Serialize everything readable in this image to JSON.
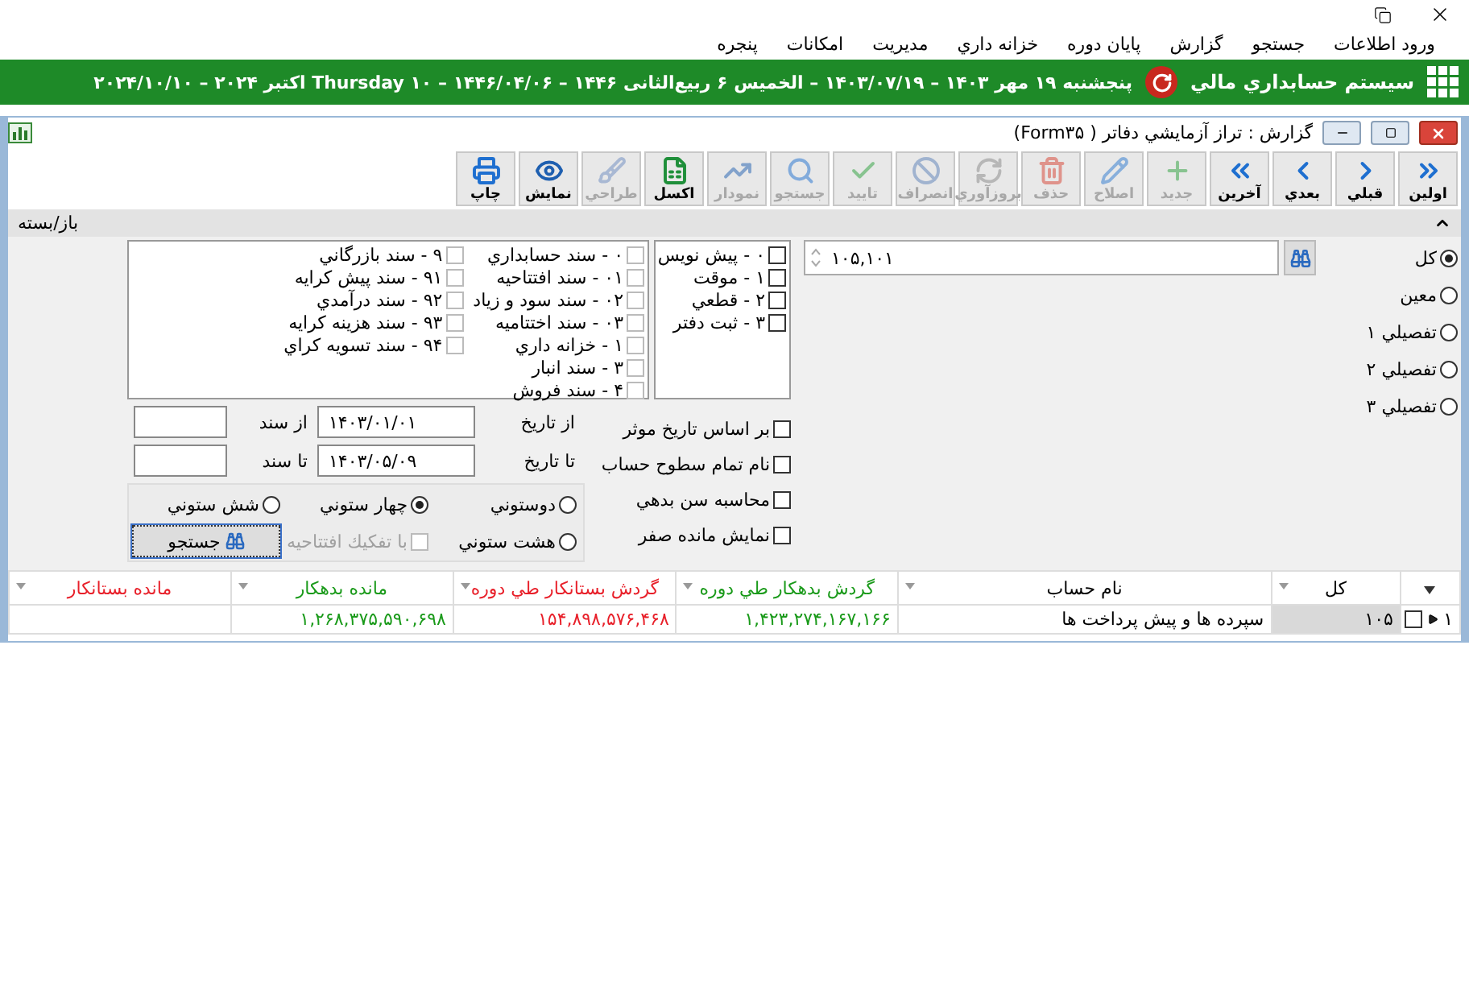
{
  "menu": [
    "ورود اطلاعات",
    "جستجو",
    "گزارش",
    "پايان دوره",
    "خزانه داري",
    "مديريت",
    "امكانات",
    "پنجره"
  ],
  "app_bar": {
    "title": "سيستم حسابداري مالي",
    "date": "پنجشنبه ۱۹ مهر ۱۴۰۳ – ۱۴۰۳/۰۷/۱۹ – الخميس ۶ ربيع‌الثانى ۱۴۴۶ – ۱۴۴۶/۰۴/۰۶ – ۱۰ Thursday اكتبر ۲۰۲۴ – ۲۰۲۴/۱۰/۱۰"
  },
  "form_window": {
    "title": "گزارش : تراز آزمايشي دفاتر ( Form۳۵)"
  },
  "toolbar": [
    {
      "label": "اولين",
      "kind": "first",
      "disabled": false
    },
    {
      "label": "قبلي",
      "kind": "prev",
      "disabled": false
    },
    {
      "label": "بعدي",
      "kind": "next",
      "disabled": false
    },
    {
      "label": "آخرين",
      "kind": "last",
      "disabled": false
    },
    {
      "label": "جديد",
      "kind": "new",
      "disabled": true
    },
    {
      "label": "اصلاح",
      "kind": "edit",
      "disabled": true
    },
    {
      "label": "حذف",
      "kind": "delete",
      "disabled": true
    },
    {
      "label": "بروزآوري",
      "kind": "refresh",
      "disabled": true
    },
    {
      "label": "انصراف",
      "kind": "cancel",
      "disabled": true
    },
    {
      "label": "تاييد",
      "kind": "confirm",
      "disabled": true
    },
    {
      "label": "جستجو",
      "kind": "search",
      "disabled": true
    },
    {
      "label": "نمودار",
      "kind": "chart",
      "disabled": true
    },
    {
      "label": "اكسل",
      "kind": "excel",
      "disabled": false
    },
    {
      "label": "طراحي",
      "kind": "design",
      "disabled": true
    },
    {
      "label": "نمايش",
      "kind": "view",
      "disabled": false
    },
    {
      "label": "چاپ",
      "kind": "print",
      "disabled": false
    }
  ],
  "panel": {
    "label": "باز/بسته",
    "expanded": true
  },
  "levels": [
    {
      "label": "كل",
      "selected": true
    },
    {
      "label": "معين",
      "selected": false
    },
    {
      "label": "تفصيلي ۱",
      "selected": false
    },
    {
      "label": "تفصيلي ۲",
      "selected": false
    },
    {
      "label": "تفصيلي ۳",
      "selected": false
    }
  ],
  "account_field": {
    "value": "۱۰۵,۱۰۱"
  },
  "statuses": [
    {
      "label": "۰ - پيش نويس",
      "checked": false
    },
    {
      "label": "۱ - موقت",
      "checked": false
    },
    {
      "label": "۲ - قطعي",
      "checked": false
    },
    {
      "label": "۳ - ثبت دفتر",
      "checked": false
    }
  ],
  "doc_types": [
    {
      "label": "۰ - سند حسابداري",
      "checked": false
    },
    {
      "label": "۰۱ - سند افتتاحيه",
      "checked": false
    },
    {
      "label": "۰۲ - سند سود و زياد",
      "checked": false
    },
    {
      "label": "۰۳ - سند اختتاميه",
      "checked": false
    },
    {
      "label": "۱ - خزانه داري",
      "checked": false
    },
    {
      "label": "۳ - سند انبار",
      "checked": false
    },
    {
      "label": "۴ - سند فروش",
      "checked": false
    },
    {
      "label": "۹ - سند بازرگاني",
      "checked": false
    },
    {
      "label": "۹۱ - سند پيش كرايه",
      "checked": false
    },
    {
      "label": "۹۲ - سند درآمدي",
      "checked": false
    },
    {
      "label": "۹۳ - سند هزينه كرايه",
      "checked": false
    },
    {
      "label": "۹۴ - سند تسويه كراي",
      "checked": false
    }
  ],
  "options": [
    {
      "label": "بر اساس تاريخ موثر",
      "checked": false
    },
    {
      "label": "نام تمام سطوح حساب",
      "checked": false
    },
    {
      "label": "محاسبه سن بدهي",
      "checked": false
    },
    {
      "label": "نمايش مانده صفر",
      "checked": false
    }
  ],
  "date_range": {
    "from_label": "از تاريخ",
    "from": "۱۴۰۳/۰۱/۰۱",
    "to_label": "تا تاريخ",
    "to": "۱۴۰۳/۰۵/۰۹"
  },
  "doc_range": {
    "from_label": "از سند",
    "to_label": "تا سند"
  },
  "layouts": [
    {
      "label": "دوستوني",
      "selected": false
    },
    {
      "label": "چهار ستوني",
      "selected": true
    },
    {
      "label": "شش ستوني",
      "selected": false
    },
    {
      "label": "هشت ستوني",
      "selected": false
    }
  ],
  "opening_split": {
    "label": "با تفكيك افتتاحيه",
    "checked": false,
    "disabled": true
  },
  "search_button": "جستجو",
  "table": {
    "columns": [
      {
        "label": "كل",
        "color": "#000000"
      },
      {
        "label": "نام حساب",
        "color": "#000000"
      },
      {
        "label": "گردش بدهكار طي دوره",
        "color": "#1a9a1a"
      },
      {
        "label": "گردش بستانكار طي دوره",
        "color": "#e8202a"
      },
      {
        "label": "مانده بدهكار",
        "color": "#1a9a1a"
      },
      {
        "label": "مانده بستانكار",
        "color": "#e8202a"
      }
    ],
    "rows": [
      {
        "number": "۱",
        "checked": false,
        "cells": [
          "۱۰۵",
          "سپرده ها و پيش پرداخت ها",
          "۱,۴۲۳,۲۷۴,۱۶۷,۱۶۶",
          "۱۵۴,۸۹۸,۵۷۶,۴۶۸",
          "۱,۲۶۸,۳۷۵,۵۹۰,۶۹۸"
        ]
      }
    ]
  }
}
